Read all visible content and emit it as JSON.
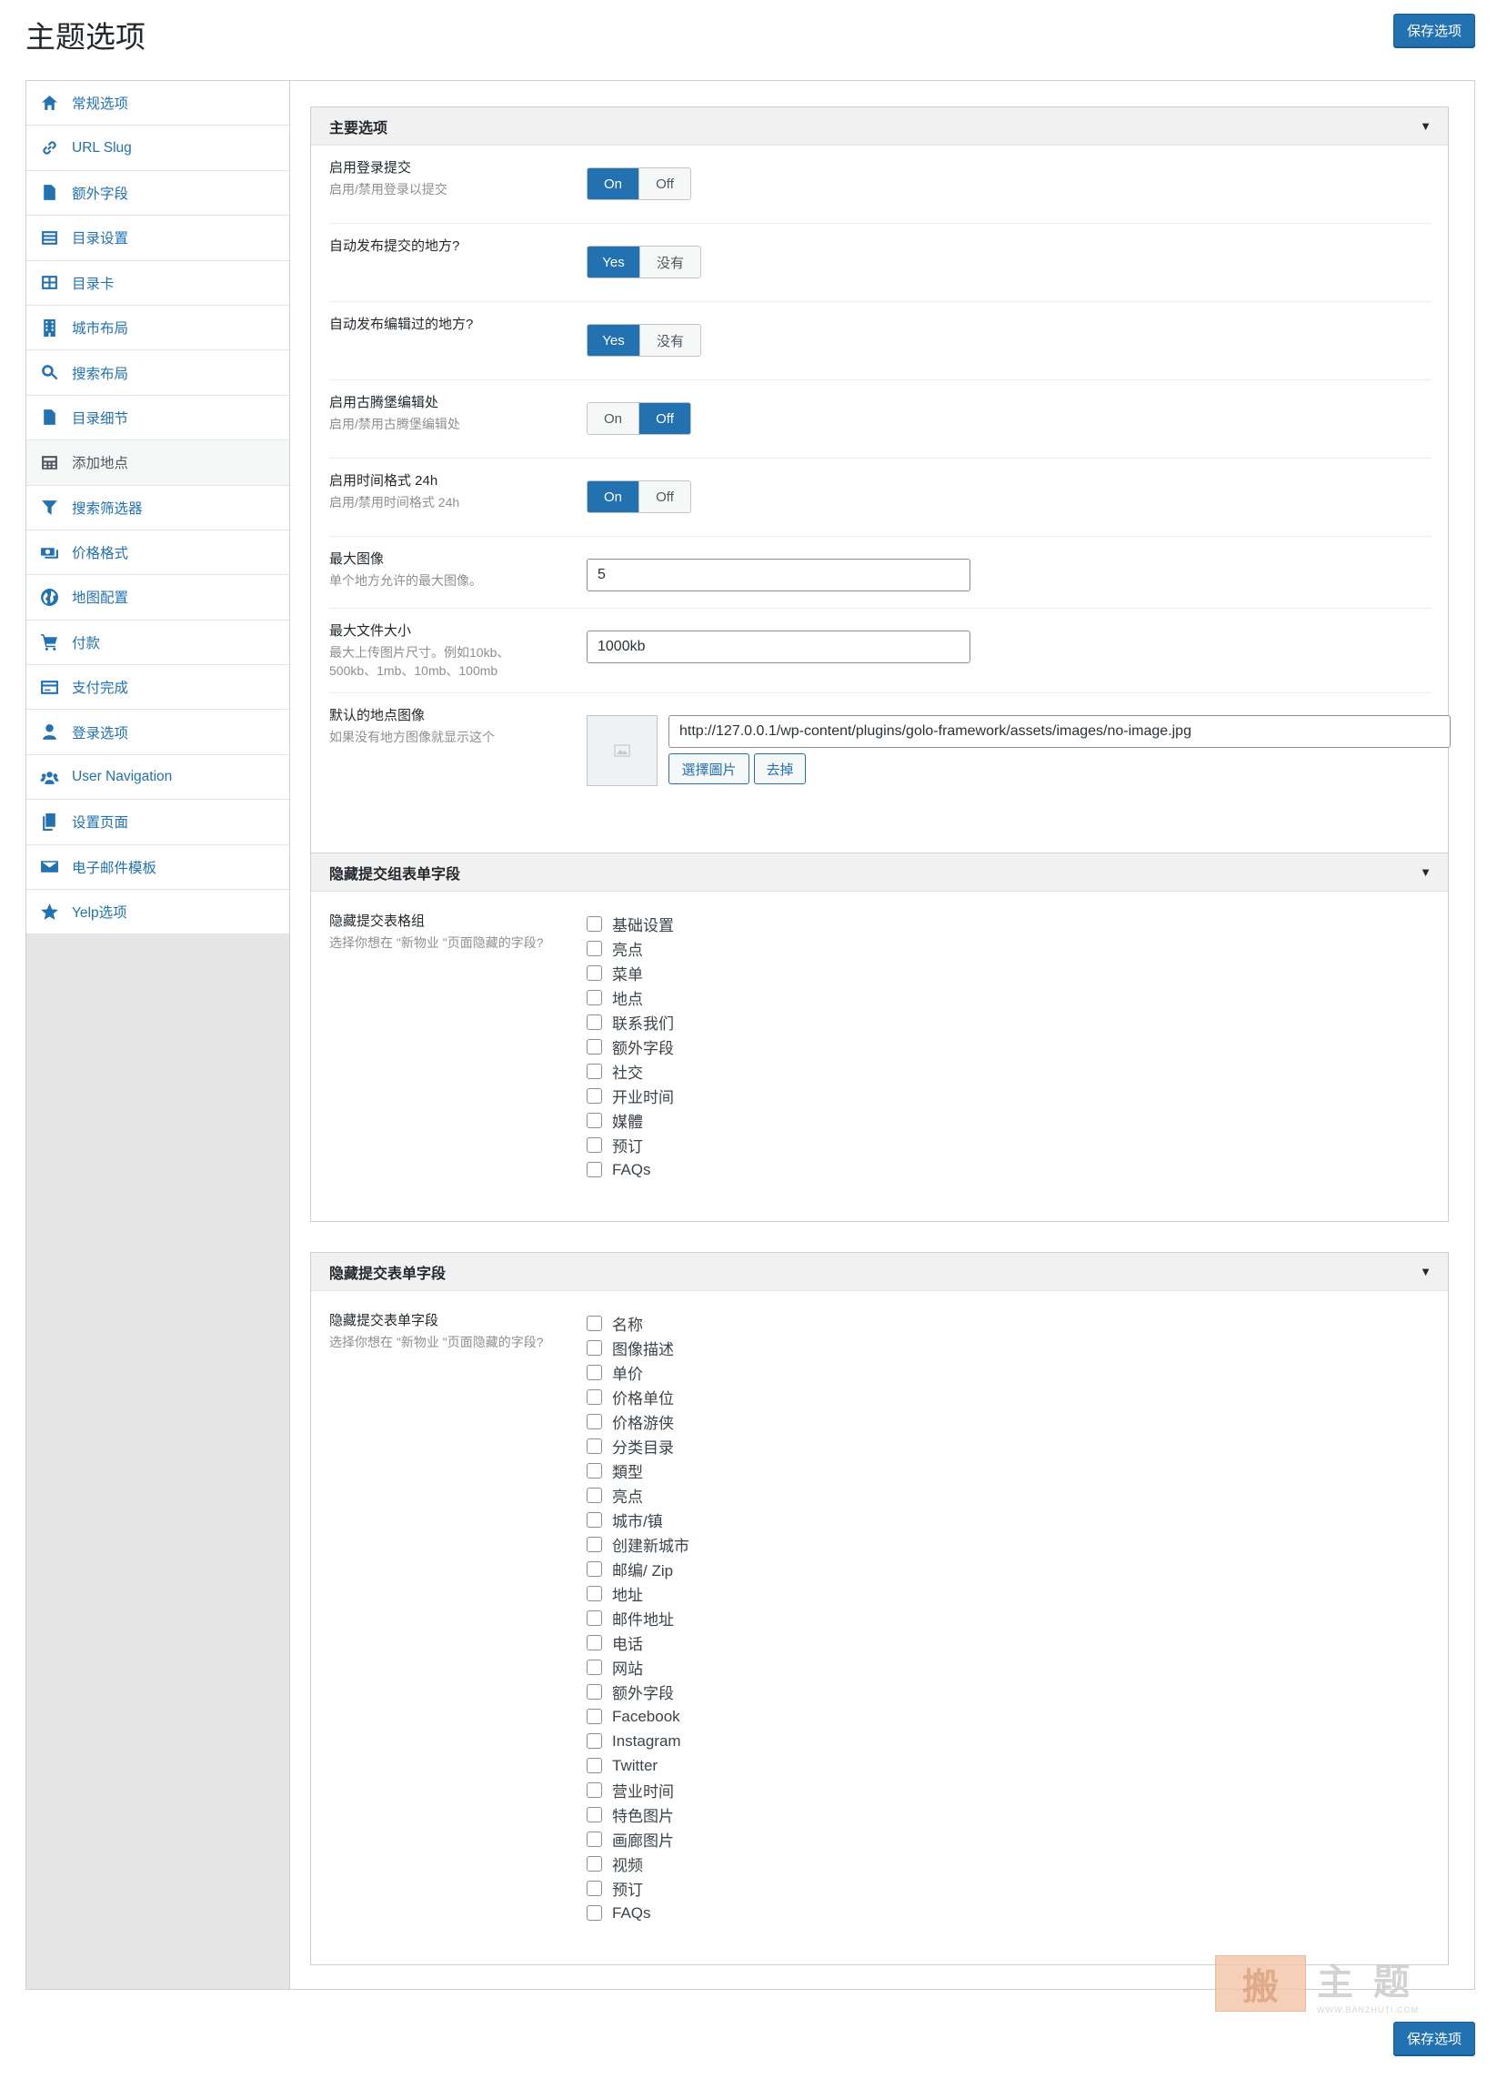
{
  "page": {
    "title": "主题选项",
    "save_label": "保存选项"
  },
  "sidebar": {
    "items": [
      {
        "label": "常规选项",
        "icon": "home-group-icon"
      },
      {
        "label": "URL Slug",
        "icon": "link-icon"
      },
      {
        "label": "额外字段",
        "icon": "document-icon"
      },
      {
        "label": "目录设置",
        "icon": "list-icon"
      },
      {
        "label": "目录卡",
        "icon": "grid-card-icon"
      },
      {
        "label": "城市布局",
        "icon": "building-icon"
      },
      {
        "label": "搜索布局",
        "icon": "search-icon"
      },
      {
        "label": "目录细节",
        "icon": "page-icon"
      },
      {
        "label": "添加地点",
        "icon": "calculator-icon",
        "active": true
      },
      {
        "label": "搜索筛选器",
        "icon": "filter-icon"
      },
      {
        "label": "价格格式",
        "icon": "money-icon"
      },
      {
        "label": "地图配置",
        "icon": "globe-icon"
      },
      {
        "label": "付款",
        "icon": "cart-icon"
      },
      {
        "label": "支付完成",
        "icon": "credit-card-icon"
      },
      {
        "label": "登录选项",
        "icon": "user-icon"
      },
      {
        "label": "User Navigation",
        "icon": "users-icon"
      },
      {
        "label": "设置页面",
        "icon": "copy-icon"
      },
      {
        "label": "电子邮件模板",
        "icon": "envelope-icon"
      },
      {
        "label": "Yelp选项",
        "icon": "star-icon"
      }
    ]
  },
  "main_panel": {
    "title": "主要选项",
    "rows": {
      "login_submit": {
        "title": "启用登录提交",
        "desc": "启用/禁用登录以提交",
        "on": "On",
        "off": "Off",
        "selected": "on"
      },
      "auto_publish": {
        "title": "自动发布提交的地方?",
        "yes": "Yes",
        "no": "没有",
        "selected": "yes"
      },
      "auto_publish_edit": {
        "title": "自动发布编辑过的地方?",
        "yes": "Yes",
        "no": "没有",
        "selected": "yes"
      },
      "gutenberg": {
        "title": "启用古腾堡编辑处",
        "desc": "启用/禁用古腾堡编辑处",
        "on": "On",
        "off": "Off",
        "selected": "off"
      },
      "time_24h": {
        "title": "启用时间格式 24h",
        "desc": "启用/禁用时间格式 24h",
        "on": "On",
        "off": "Off",
        "selected": "on"
      },
      "max_images": {
        "title": "最大图像",
        "desc": "单个地方允许的最大图像。",
        "value": "5"
      },
      "max_file_size": {
        "title": "最大文件大小",
        "desc": "最大上传图片尺寸。例如10kb、500kb、1mb、10mb、100mb",
        "value": "1000kb"
      },
      "default_image": {
        "title": "默认的地点图像",
        "desc": "如果没有地方图像就显示这个",
        "value": "http://127.0.0.1/wp-content/plugins/golo-framework/assets/images/no-image.jpg",
        "choose_label": "選擇圖片",
        "remove_label": "去掉"
      }
    }
  },
  "group_panel": {
    "title": "隐藏提交组表单字段",
    "row_title": "隐藏提交表格组",
    "row_desc": "选择你想在 \"新物业 \"页面隐藏的字段?",
    "options": [
      "基础设置",
      "亮点",
      "菜单",
      "地点",
      "联系我们",
      "额外字段",
      "社交",
      "开业时间",
      "媒體",
      "预订",
      "FAQs"
    ]
  },
  "field_panel": {
    "title": "隐藏提交表单字段",
    "row_title": "隐藏提交表单字段",
    "row_desc": "选择你想在 \"新物业 \"页面隐藏的字段?",
    "options": [
      "名称",
      "图像描述",
      "单价",
      "价格单位",
      "价格游侠",
      "分类目录",
      "類型",
      "亮点",
      "城市/镇",
      "创建新城市",
      "邮编/ Zip",
      "地址",
      "邮件地址",
      "电话",
      "网站",
      "额外字段",
      "Facebook",
      "Instagram",
      "Twitter",
      "营业时间",
      "特色图片",
      "画廊图片",
      "视频",
      "预订",
      "FAQs"
    ]
  },
  "watermark": {
    "main": "主题",
    "sub": "WWW.BANZHUTI.COM"
  },
  "colors": {
    "accent": "#2271b1",
    "sidebar_bg": "#e5e5e5",
    "panel_head": "#f1f1f1"
  }
}
